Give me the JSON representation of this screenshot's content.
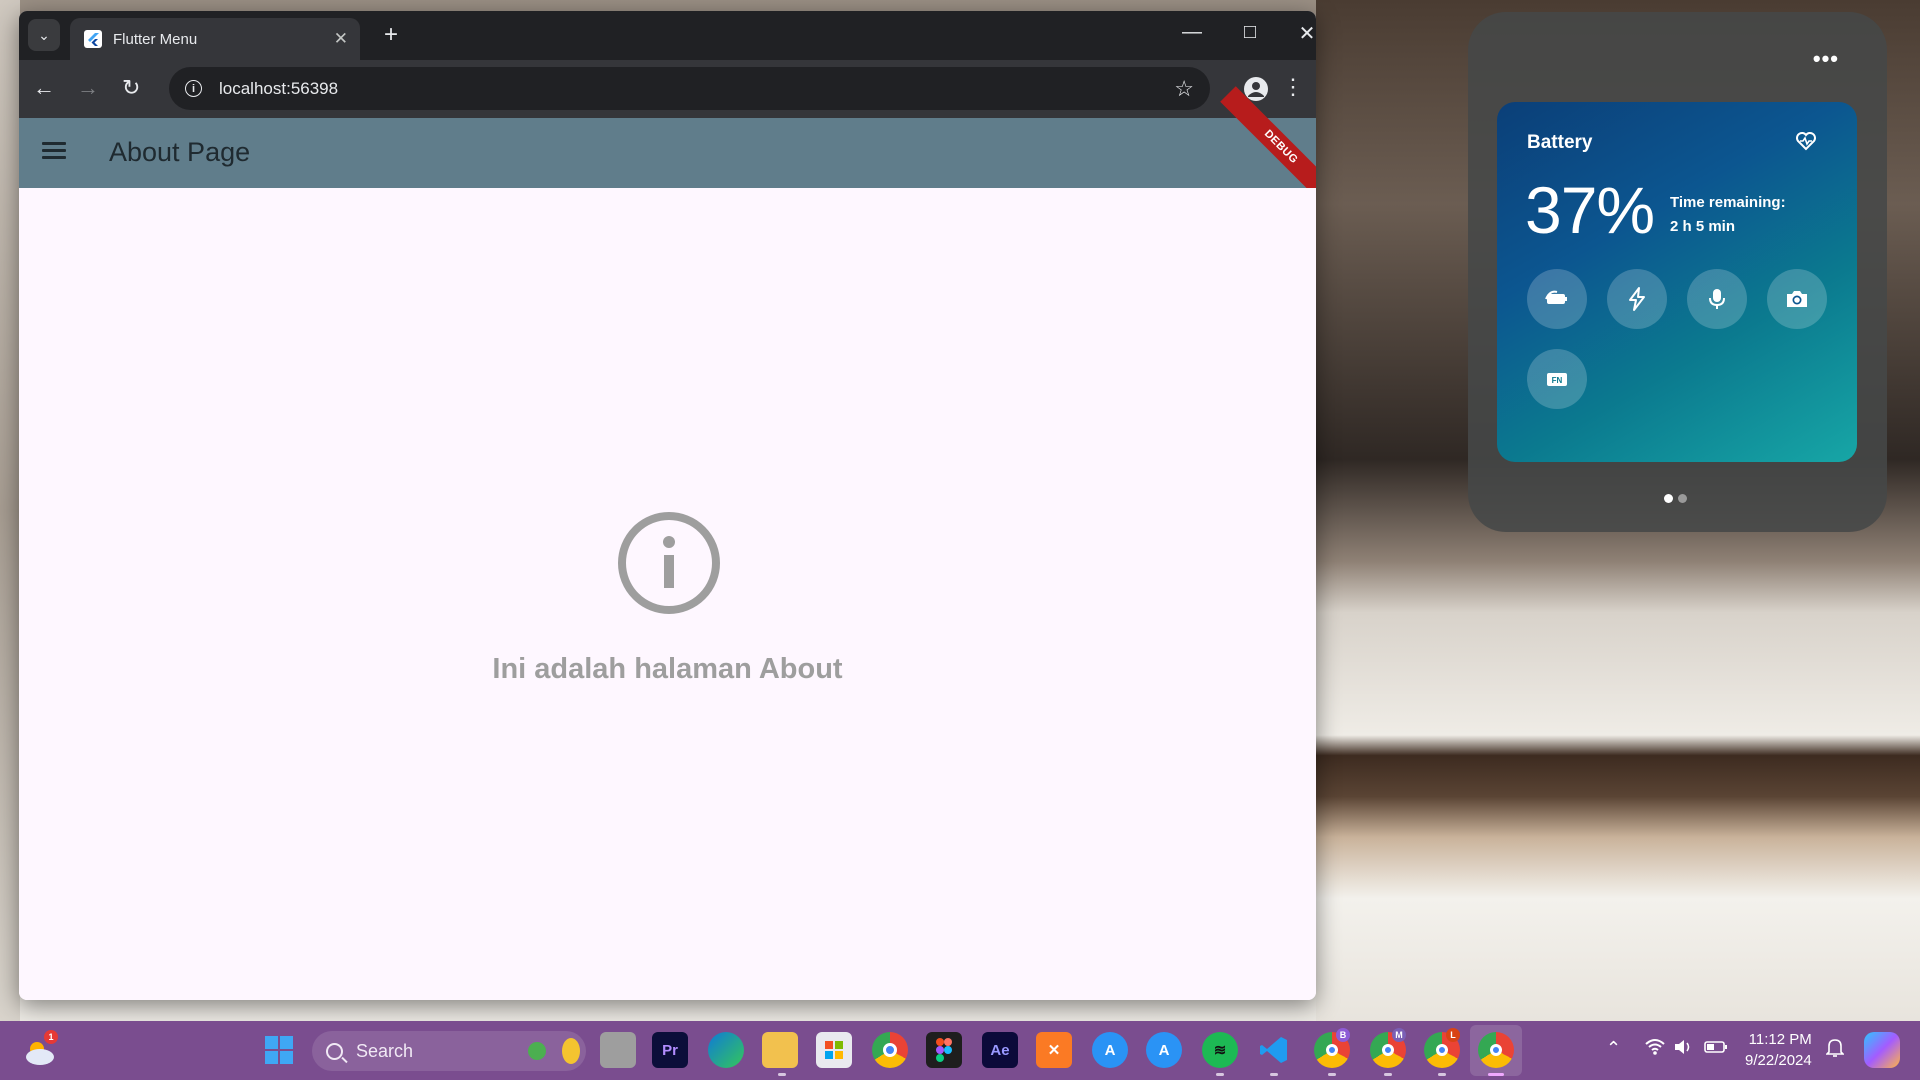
{
  "browser": {
    "tab_title": "Flutter Menu",
    "url": "localhost:56398"
  },
  "app": {
    "title": "About Page",
    "debug_label": "DEBUG",
    "message": "Ini adalah halaman About"
  },
  "battery": {
    "label": "Battery",
    "percent_text": "37%",
    "remaining_label": "Time remaining:",
    "remaining_value": "2 h 5 min",
    "fn_label": "FN",
    "buttons": [
      "battery-saver-icon",
      "power-mode-icon",
      "microphone-icon",
      "camera-icon",
      "fn-key-icon"
    ]
  },
  "taskbar": {
    "search_placeholder": "Search",
    "weather_badge": "1",
    "apps": [
      "weather",
      "copilot",
      "file-manager",
      "premiere-pro",
      "edge",
      "file-explorer",
      "microsoft-store",
      "chrome",
      "figma",
      "after-effects",
      "xampp",
      "app-store-a",
      "app-store-b",
      "spotify",
      "vscode",
      "chrome-profile-b",
      "chrome-profile-m",
      "chrome-profile-l",
      "chrome-active"
    ],
    "profile_badges": [
      "B",
      "M",
      "L"
    ],
    "time": "11:12 PM",
    "date": "9/22/2024"
  },
  "colors": {
    "appbar": "#607d8b",
    "app_background": "#fef7ff",
    "taskbar": "#7a4d8f"
  }
}
